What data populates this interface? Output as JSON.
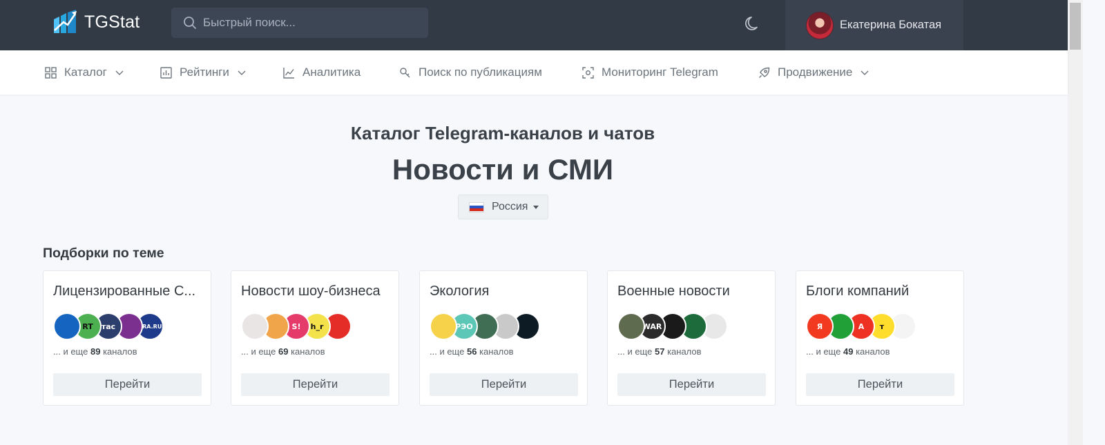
{
  "header": {
    "brand": "TGStat",
    "search_placeholder": "Быстрый поиск...",
    "user_name": "Екатерина Бокатая"
  },
  "nav": {
    "items": [
      {
        "label": "Каталог",
        "icon": "grid-icon",
        "has_dropdown": true
      },
      {
        "label": "Рейтинги",
        "icon": "bar-chart-icon",
        "has_dropdown": true
      },
      {
        "label": "Аналитика",
        "icon": "line-chart-icon",
        "has_dropdown": false
      },
      {
        "label": "Поиск по публикациям",
        "icon": "search-key-icon",
        "has_dropdown": false
      },
      {
        "label": "Мониторинг Telegram",
        "icon": "scan-icon",
        "has_dropdown": false
      },
      {
        "label": "Продвижение",
        "icon": "rocket-icon",
        "has_dropdown": true
      }
    ]
  },
  "main": {
    "subtitle": "Каталог Telegram-каналов и чатов",
    "title": "Новости и СМИ",
    "country": "Россия"
  },
  "collections": {
    "heading": "Подборки по теме",
    "more_prefix": "... и еще",
    "more_suffix": "каналов",
    "button_label": "Перейти",
    "cards": [
      {
        "title": "Лицензированные С...",
        "count": "89",
        "avatars": [
          {
            "bg": "#1565c0",
            "text": "",
            "fg": "#ffffff"
          },
          {
            "bg": "#4caf50",
            "text": "RT",
            "fg": "#111111"
          },
          {
            "bg": "#2c3e6b",
            "text": "тас",
            "fg": "#ffffff"
          },
          {
            "bg": "#7b2f8f",
            "text": "",
            "fg": "#ffffff"
          },
          {
            "bg": "#1e3a8a",
            "text": "URA.RU",
            "fg": "#ffffff"
          }
        ]
      },
      {
        "title": "Новости шоу-бизнеса",
        "count": "69",
        "avatars": [
          {
            "bg": "#e9e5e4",
            "text": "",
            "fg": "#333333"
          },
          {
            "bg": "#f1a54a",
            "text": "",
            "fg": "#ffffff"
          },
          {
            "bg": "#e43b6b",
            "text": "S!",
            "fg": "#ffffff"
          },
          {
            "bg": "#f3e24a",
            "text": "h_r",
            "fg": "#111111"
          },
          {
            "bg": "#e52d27",
            "text": "",
            "fg": "#ffea00"
          }
        ]
      },
      {
        "title": "Экология",
        "count": "56",
        "avatars": [
          {
            "bg": "#f5d24a",
            "text": "",
            "fg": "#111111"
          },
          {
            "bg": "#5cc7b6",
            "text": "РЭО",
            "fg": "#ffffff"
          },
          {
            "bg": "#3f6e54",
            "text": "",
            "fg": "#ffffff"
          },
          {
            "bg": "#c9c9c9",
            "text": "",
            "fg": "#333333"
          },
          {
            "bg": "#0d1b24",
            "text": "",
            "fg": "#5ef0e0"
          }
        ]
      },
      {
        "title": "Военные новости",
        "count": "57",
        "avatars": [
          {
            "bg": "#5f6b4e",
            "text": "",
            "fg": "#ffffff"
          },
          {
            "bg": "#2b2b2b",
            "text": "WAR",
            "fg": "#ffffff"
          },
          {
            "bg": "#1a1a1a",
            "text": "",
            "fg": "#ffffff"
          },
          {
            "bg": "#1d6b3a",
            "text": "",
            "fg": "#ffffff"
          },
          {
            "bg": "#e8e8e8",
            "text": "",
            "fg": "#111111"
          }
        ]
      },
      {
        "title": "Блоги компаний",
        "count": "49",
        "avatars": [
          {
            "bg": "#f23a21",
            "text": "Я",
            "fg": "#ffffff"
          },
          {
            "bg": "#21a038",
            "text": "",
            "fg": "#ffffff"
          },
          {
            "bg": "#ef3124",
            "text": "А",
            "fg": "#ffffff"
          },
          {
            "bg": "#ffdd2d",
            "text": "т",
            "fg": "#111111"
          },
          {
            "bg": "#f4f4f4",
            "text": "",
            "fg": "#3dbf5a"
          }
        ]
      }
    ]
  }
}
